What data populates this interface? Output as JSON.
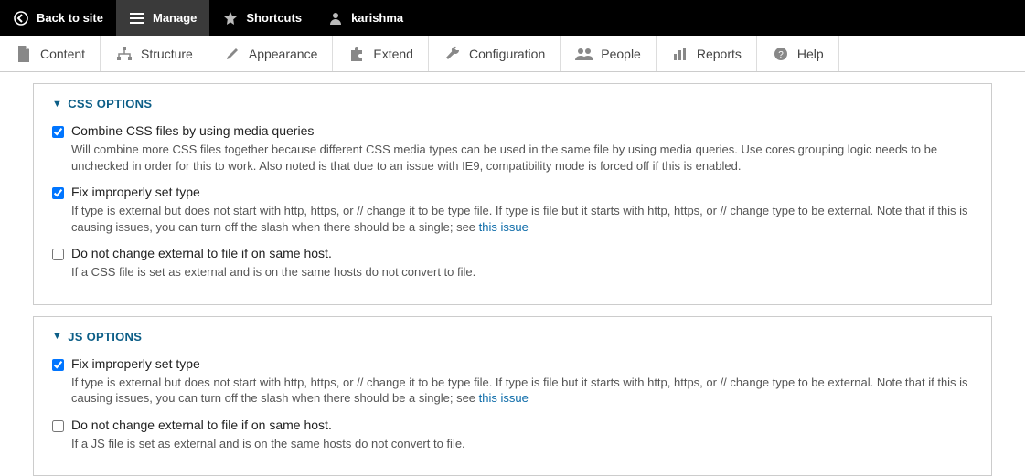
{
  "topbar": {
    "back": "Back to site",
    "manage": "Manage",
    "shortcuts": "Shortcuts",
    "user": "karishma"
  },
  "tabs": {
    "content": "Content",
    "structure": "Structure",
    "appearance": "Appearance",
    "extend": "Extend",
    "configuration": "Configuration",
    "people": "People",
    "reports": "Reports",
    "help": "Help"
  },
  "sections": [
    {
      "title": "CSS OPTIONS",
      "options": [
        {
          "checked": true,
          "label": "Combine CSS files by using media queries",
          "desc": "Will combine more CSS files together because different CSS media types can be used in the same file by using media queries. Use cores grouping logic needs to be unchecked in order for this to work. Also noted is that due to an issue with IE9, compatibility mode is forced off if this is enabled.",
          "link": null
        },
        {
          "checked": true,
          "label": "Fix improperly set type",
          "desc": "If type is external but does not start with http, https, or // change it to be type file. If type is file but it starts with http, https, or // change type to be external. Note that if this is causing issues, you can turn off the slash when there should be a single; see ",
          "link": "this issue"
        },
        {
          "checked": false,
          "label": "Do not change external to file if on same host.",
          "desc": "If a CSS file is set as external and is on the same hosts do not convert to file.",
          "link": null
        }
      ]
    },
    {
      "title": "JS OPTIONS",
      "options": [
        {
          "checked": true,
          "label": "Fix improperly set type",
          "desc": "If type is external but does not start with http, https, or // change it to be type file. If type is file but it starts with http, https, or // change type to be external. Note that if this is causing issues, you can turn off the slash when there should be a single; see ",
          "link": "this issue"
        },
        {
          "checked": false,
          "label": "Do not change external to file if on same host.",
          "desc": "If a JS file is set as external and is on the same hosts do not convert to file.",
          "link": null
        }
      ]
    }
  ]
}
